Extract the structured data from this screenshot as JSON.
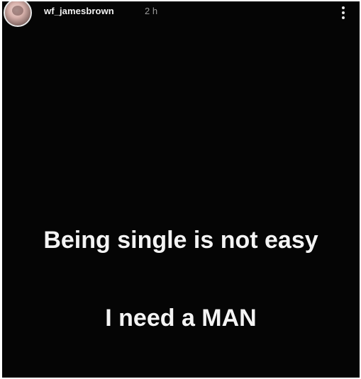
{
  "story": {
    "username": "wf_jamesbrown",
    "time_ago": "2 h",
    "more_icon": "more-vertical-icon",
    "text_line_1": "Being single is not easy",
    "text_line_2": "I need a MAN",
    "background_color": "#050505",
    "text_color": "#f4f4f4"
  }
}
